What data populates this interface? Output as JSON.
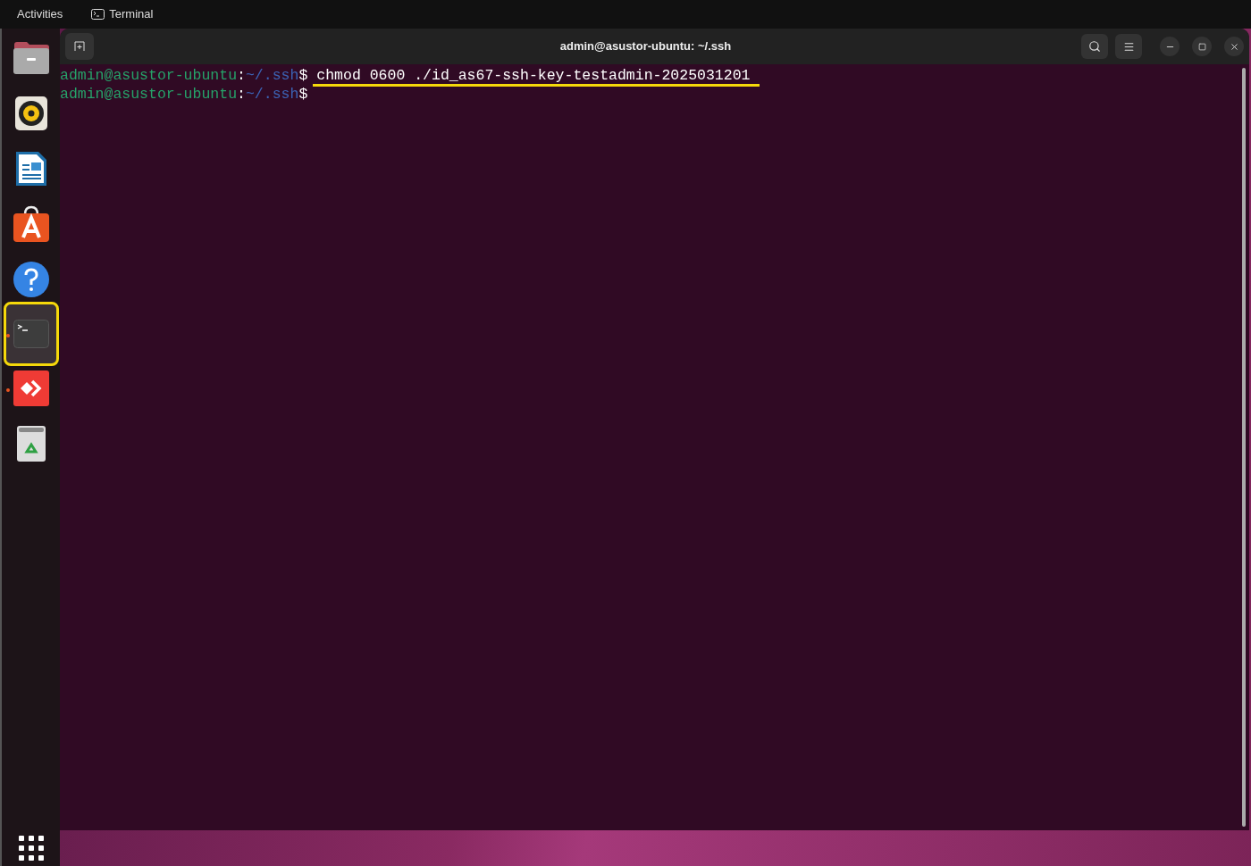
{
  "top_bar": {
    "activities": "Activities",
    "app_name": "Terminal"
  },
  "dock": {
    "items": [
      {
        "kind": "files",
        "running": false,
        "selected": false
      },
      {
        "kind": "music",
        "running": false,
        "selected": false
      },
      {
        "kind": "writer",
        "running": false,
        "selected": false
      },
      {
        "kind": "store",
        "running": false,
        "selected": false
      },
      {
        "kind": "help",
        "running": false,
        "selected": false
      },
      {
        "kind": "terminal",
        "running": true,
        "selected": true
      },
      {
        "kind": "remote",
        "running": true,
        "selected": false
      },
      {
        "kind": "trash",
        "running": false,
        "selected": false
      }
    ]
  },
  "window": {
    "title": "admin@asustor-ubuntu: ~/.ssh"
  },
  "terminal": {
    "lines": [
      {
        "user": "admin@asustor-ubuntu",
        "separator": ":",
        "path": "~/.ssh",
        "symbol": "$",
        "command": "chmod 0600 ./id_as67-ssh-key-testadmin-2025031201",
        "highlighted": true
      },
      {
        "user": "admin@asustor-ubuntu",
        "separator": ":",
        "path": "~/.ssh",
        "symbol": "$"
      }
    ]
  }
}
